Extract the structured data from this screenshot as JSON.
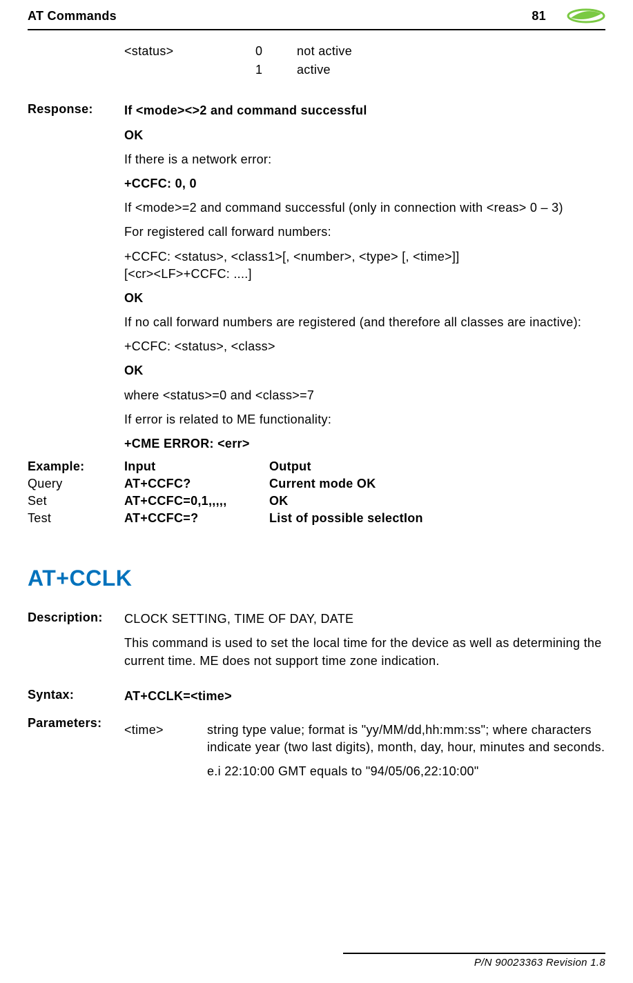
{
  "header": {
    "left": "AT Commands",
    "page": "81"
  },
  "status": {
    "param": "<status>",
    "rows": [
      {
        "code": "0",
        "desc": "not active"
      },
      {
        "code": "1",
        "desc": "active"
      }
    ]
  },
  "response": {
    "label": "Response:",
    "line1": "If <mode><>2 and command successful",
    "ok1": "OK",
    "line2": "If there is a network error:",
    "ccfc00": "+CCFC: 0, 0",
    "line3": "If <mode>=2 and command successful (only in connection with <reas> 0 – 3)",
    "line4": "For registered call forward numbers:",
    "line5a": "+CCFC: <status>, <class1>[, <number>, <type> [, <time>]]",
    "line5b": "[<cr><LF>+CCFC: ....]",
    "ok2": "OK",
    "line6": "If no call forward numbers are registered (and therefore all classes are inactive):",
    "line7": "+CCFC: <status>, <class>",
    "ok3": "OK",
    "line8": "where <status>=0 and <class>=7",
    "line9": "If error is related to ME functionality:",
    "cmeerr": "+CME ERROR: <err>"
  },
  "example": {
    "label": "Example:",
    "hdr_input": "Input",
    "hdr_output": "Output",
    "rows": [
      {
        "type": "Query",
        "input": "AT+CCFC?",
        "output": "Current mode OK"
      },
      {
        "type": "Set",
        "input": "AT+CCFC=0,1,,,,,",
        "output": "OK"
      },
      {
        "type": "Test",
        "input": "AT+CCFC=?",
        "output": "List of possible selectIon"
      }
    ]
  },
  "atcclk": {
    "title": "AT+CCLK",
    "desc_label": "Description:",
    "desc_line1": "CLOCK SETTING, TIME OF DAY, DATE",
    "desc_line2": "This command is used to set the local time for the device as well as determining the current time. ME does not support time zone indication.",
    "syntax_label": "Syntax:",
    "syntax_value": "AT+CCLK=<time>",
    "params_label": "Parameters:",
    "param_name": "<time>",
    "param_desc1": "string type value; format is \"yy/MM/dd,hh:mm:ss\"; where characters indicate year (two last digits), month, day, hour, minutes and seconds.",
    "param_desc2": "e.i 22:10:00 GMT equals to \"94/05/06,22:10:00\""
  },
  "footer": {
    "text": "P/N 90023363  Revision 1.8"
  }
}
